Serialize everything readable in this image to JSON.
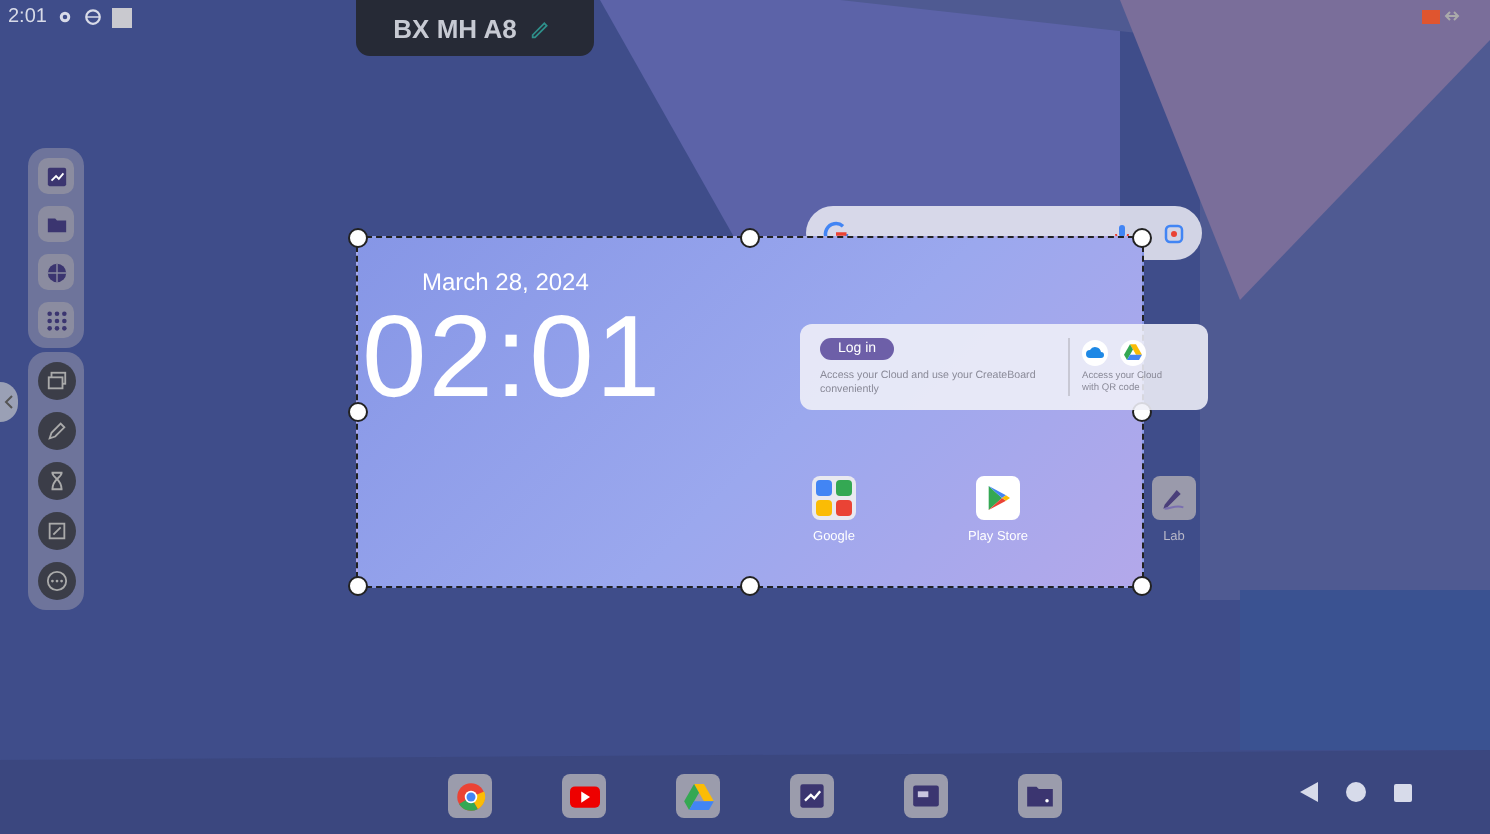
{
  "status_bar": {
    "time": "2:01"
  },
  "title_pill": {
    "label": "BX MH A8"
  },
  "clock_widget": {
    "date": "March 28, 2024",
    "time": "02:01",
    "selected": true
  },
  "cloud_card": {
    "button": "Log in",
    "description": "Access your Cloud and use your CreateBoard conveniently",
    "qr_caption": "Access your Cloud with QR code"
  },
  "apps": [
    {
      "label": "Google",
      "kind": "folder"
    },
    {
      "label": "Play Store",
      "kind": "store"
    },
    {
      "label": "Lab",
      "kind": "pen"
    }
  ]
}
